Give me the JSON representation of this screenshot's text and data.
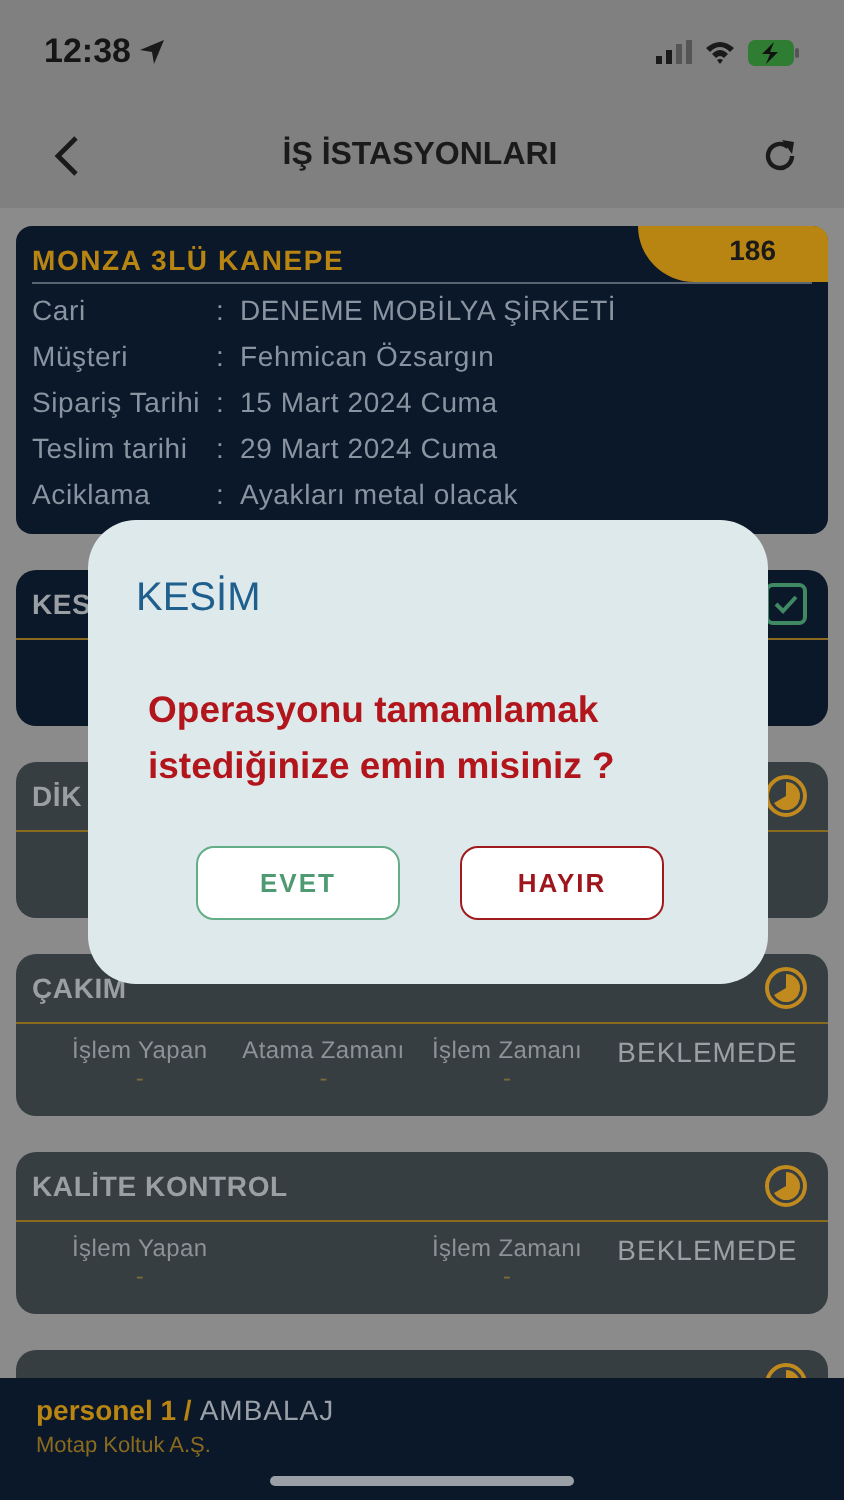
{
  "status_bar": {
    "time": "12:38"
  },
  "nav": {
    "title": "İŞ İSTASYONLARI"
  },
  "order": {
    "title": "MONZA 3LÜ KANEPE",
    "badge": "186",
    "rows": [
      {
        "label": "Cari",
        "sep": ":",
        "value": "DENEME MOBİLYA ŞİRKETİ"
      },
      {
        "label": "Müşteri",
        "sep": ":",
        "value": "Fehmican Özsargın"
      },
      {
        "label": "Sipariş Tarihi",
        "sep": ":",
        "value": "15 Mart 2024 Cuma"
      },
      {
        "label": "Teslim tarihi",
        "sep": ":",
        "value": "29 Mart 2024 Cuma"
      },
      {
        "label": "Aciklama",
        "sep": ":",
        "value": "Ayakları metal olacak"
      }
    ]
  },
  "stations": [
    {
      "title": "KES",
      "kind": "check"
    },
    {
      "title": "DİK",
      "kind": "clock"
    },
    {
      "title": "ÇAKIM",
      "kind": "clock",
      "fields": [
        {
          "label": "İşlem Yapan",
          "value": "-"
        },
        {
          "label": "Atama Zamanı",
          "value": "-"
        },
        {
          "label": "İşlem Zamanı",
          "value": "-"
        }
      ],
      "status": "BEKLEMEDE"
    },
    {
      "title": "KALİTE KONTROL",
      "kind": "clock",
      "fields": [
        {
          "label": "İşlem Yapan",
          "value": "-"
        },
        {
          "label": "İşlem Zamanı",
          "value": "-"
        }
      ],
      "status": "BEKLEMEDE"
    },
    {
      "kind": "clock"
    }
  ],
  "footer": {
    "user": "personel 1 /",
    "station": "AMBALAJ",
    "company": "Motap Koltuk A.Ş."
  },
  "dialog": {
    "title": "KESİM",
    "message": "Operasyonu tamamlamak istediğinize emin misiniz ?",
    "buttons": [
      {
        "label": "EVET",
        "kind": "confirm"
      },
      {
        "label": "HAYIR",
        "kind": "cancel"
      }
    ]
  }
}
